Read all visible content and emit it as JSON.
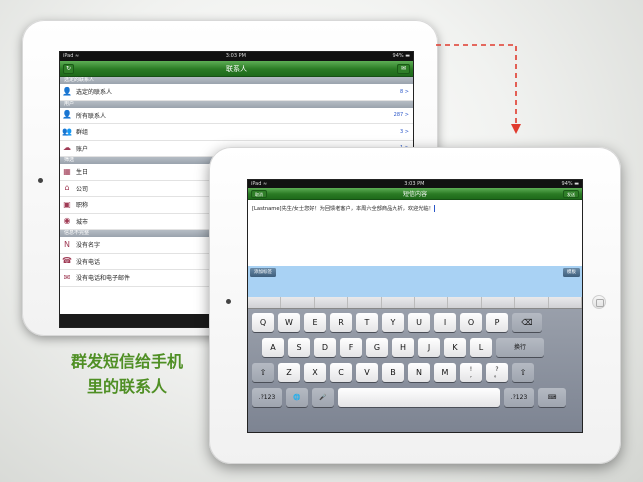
{
  "back_ipad": {
    "status": {
      "left": "iPad ≈",
      "time": "3:03 PM",
      "battery": "94% ▬"
    },
    "nav_title": "联系人",
    "nav_left_icon": "refresh-icon",
    "nav_right_icon": "chat-icon",
    "sections": [
      {
        "header": "选定的联系人",
        "rows": [
          {
            "icon": "user-icon",
            "label": "选定的联系人",
            "count": "8 >"
          }
        ]
      },
      {
        "header": "用户",
        "rows": [
          {
            "icon": "user-icon",
            "label": "所有联系人",
            "count": "287 >"
          },
          {
            "icon": "group-icon",
            "label": "群组",
            "count": "3 >"
          },
          {
            "icon": "cloud-icon",
            "label": "账户",
            "count": "1 >"
          }
        ]
      },
      {
        "header": "筛选",
        "rows": [
          {
            "icon": "calendar-icon",
            "label": "生日",
            "count": ""
          },
          {
            "icon": "building-icon",
            "label": "公司",
            "count": ""
          },
          {
            "icon": "badge-icon",
            "label": "职称",
            "count": ""
          },
          {
            "icon": "globe-icon",
            "label": "城市",
            "count": ""
          }
        ]
      },
      {
        "header": "信息不完整",
        "rows": [
          {
            "icon": "no-name-icon",
            "label": "没有名字",
            "count": ""
          },
          {
            "icon": "no-phone-icon",
            "label": "没有电话",
            "count": ""
          },
          {
            "icon": "no-mail-icon",
            "label": "没有电话和电子邮件",
            "count": ""
          }
        ]
      }
    ],
    "bottom_icon": "X"
  },
  "front_ipad": {
    "status": {
      "left": "iPad ≈",
      "time": "3:03 PM",
      "battery": "94% ▬"
    },
    "nav_title": "短信内容",
    "nav_left": "取消",
    "nav_right": "发送",
    "message": "[Lastname]先生/女士您好！为回馈老客户，本周六全部商品九折，欢迎光临！",
    "add_tag_button": "添加标签",
    "template_button": "模板",
    "keyboard": {
      "row1": [
        "Q",
        "W",
        "E",
        "R",
        "T",
        "Y",
        "U",
        "I",
        "O",
        "P"
      ],
      "row2": [
        "A",
        "S",
        "D",
        "F",
        "G",
        "H",
        "J",
        "K",
        "L"
      ],
      "row3": [
        "Z",
        "X",
        "C",
        "V",
        "B",
        "N",
        "M"
      ],
      "row3_extra": [
        {
          "top": "!",
          "bottom": ","
        },
        {
          "top": "?",
          "bottom": "。"
        }
      ],
      "return": "换行",
      "shift": "⇧",
      "delete": "⌫",
      "num": ".?123",
      "globe": "🌐",
      "mic": "🎤",
      "hide": "⌨"
    }
  },
  "caption": {
    "line1": "群发短信给手机",
    "line2": "里的联系人"
  },
  "colors": {
    "accent_green": "#4f8f24",
    "arrow_red": "#e03b2e"
  }
}
